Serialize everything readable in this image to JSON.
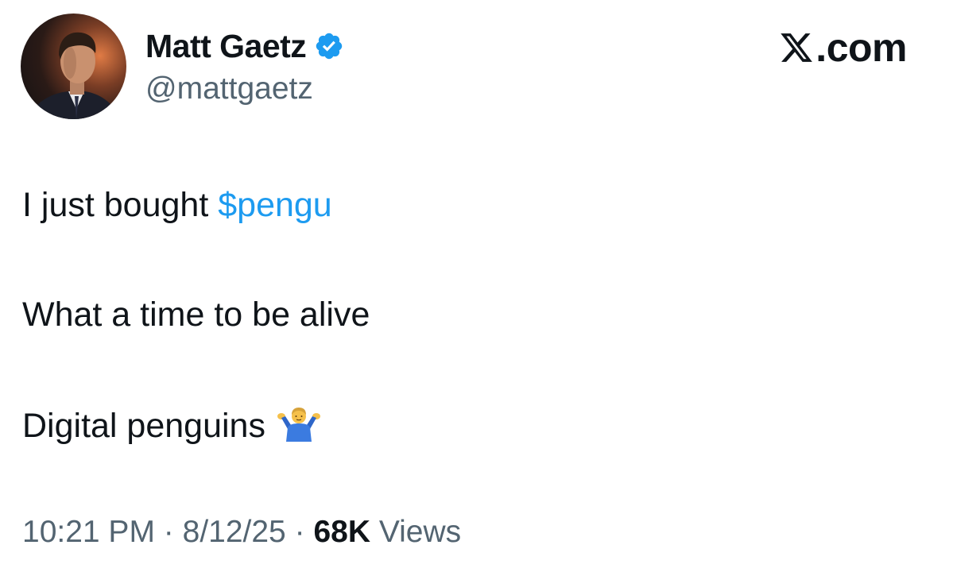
{
  "author": {
    "display_name": "Matt Gaetz",
    "handle": "@mattgaetz",
    "verified": true,
    "avatar_icon": "profile-photo"
  },
  "brand": {
    "logo_text": ".com",
    "logo_icon": "x-logo-icon"
  },
  "tweet": {
    "line1_prefix": "I just bought ",
    "cashtag": "$pengu",
    "line2": "What a time to be alive",
    "line3": "Digital penguins",
    "line3_emoji": "man-shrugging-emoji"
  },
  "meta": {
    "time": "10:21 PM",
    "separator": "·",
    "date": "8/12/25",
    "views_count": "68K",
    "views_label": "Views"
  },
  "colors": {
    "text": "#0f1419",
    "secondary": "#536471",
    "link": "#1d9bf0",
    "verified": "#1d9bf0"
  }
}
